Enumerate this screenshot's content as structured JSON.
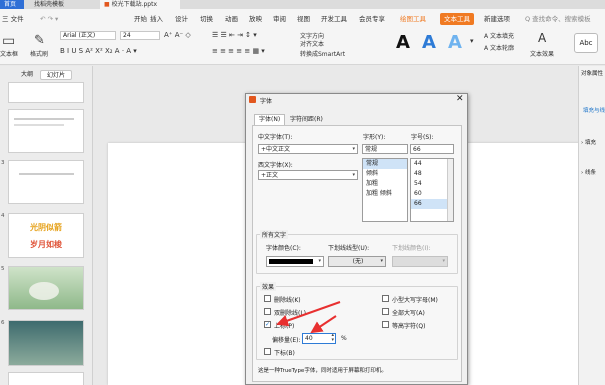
{
  "titlebar": {
    "tabs": [
      "首页",
      "找稻壳模板",
      "校光下载站.pptx"
    ]
  },
  "menu": {
    "file": "三 文件",
    "items": [
      "开始",
      "插入",
      "设计",
      "切换",
      "动画",
      "放映",
      "审阅",
      "视图",
      "开发工具",
      "会员专享"
    ],
    "draw_tool": "绘图工具",
    "text_tool": "文本工具",
    "new_tab": "新建选项",
    "search_placeholder": "Q 查找命令、搜索模板"
  },
  "toolbar": {
    "font_name": "Arial (正文)",
    "font_size": "24",
    "textbox": "文本框",
    "format_painter": "格式刷",
    "text_direction": "文字方向",
    "align_text": "对齐文本",
    "smartart": "转换成SmartArt",
    "text_fill": "文本填充",
    "text_outline": "文本轮廓",
    "text_effect": "文本效果",
    "abc": "Abc"
  },
  "left_panel": {
    "tab_outline": "大纲",
    "tab_slides": "幻灯片",
    "slide_numbers": [
      "",
      "",
      "3",
      "4",
      "5",
      "6"
    ],
    "slide4_lines": [
      "光阴似箭",
      "岁月如梭"
    ]
  },
  "right_panel": {
    "title": "对象属性",
    "items": [
      "填充与线条",
      "填充",
      "线条"
    ]
  },
  "dialog": {
    "title": "字体",
    "tab_font": "字体(N)",
    "tab_spacing": "字符间距(R)",
    "latin_font_label": "中文字体(T):",
    "latin_font_value": "+中文正文",
    "style_label": "字形(Y):",
    "style_value": "常规",
    "size_label": "字号(S):",
    "size_value": "66",
    "western_font_label": "西文字体(X):",
    "western_font_value": "+正文",
    "styles": [
      "常规",
      "倾斜",
      "加粗",
      "加粗 倾斜"
    ],
    "sizes": [
      "44",
      "48",
      "54",
      "60",
      "66"
    ],
    "all_text_label": "所有文字",
    "font_color_label": "字体颜色(C):",
    "underline_type_label": "下划线线型(U):",
    "underline_type_value": "(无)",
    "underline_color_label": "下划线颜色(I):",
    "font_color": "#000000",
    "effects_label": "效果",
    "effects": {
      "strikethrough": "删除线(K)",
      "double_strike": "双删除线(L)",
      "superscript": "上标(P)",
      "offset_label": "偏移量(E):",
      "offset_value": "40",
      "offset_unit": "%",
      "subscript": "下标(B)",
      "small_caps": "小型大写字母(M)",
      "all_caps": "全部大写(A)",
      "equal_height": "等高字符(Q)"
    },
    "checked": {
      "superscript": true,
      "strikethrough": false,
      "double_strike": false,
      "subscript": false,
      "small_caps": false,
      "all_caps": false,
      "equal_height": false
    },
    "footer_note": "这是一种TrueType字体，同时适用于屏幕和打印机。"
  },
  "annotation": {
    "color": "#e83030"
  }
}
